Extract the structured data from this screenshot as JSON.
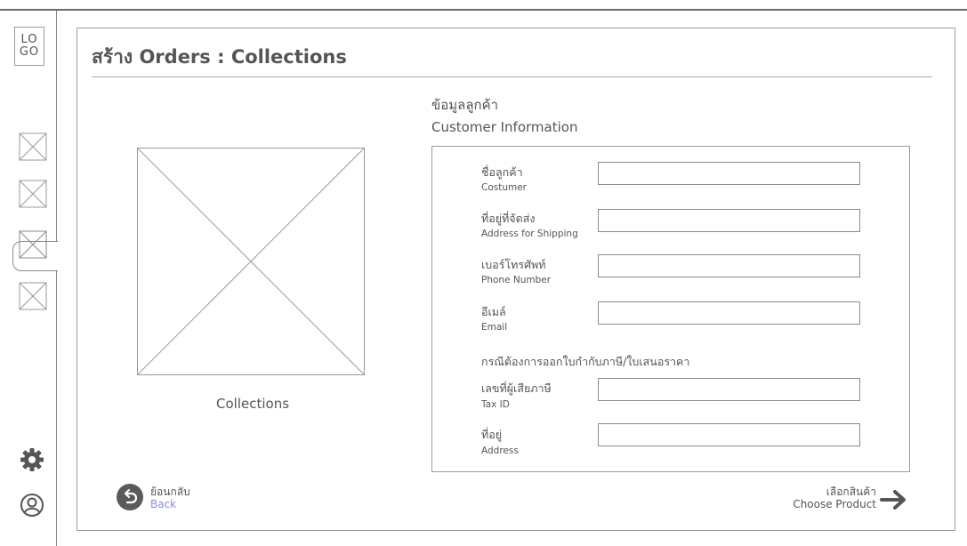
{
  "sidebar": {
    "logo_line1": "LO",
    "logo_line2": "GO",
    "nav_items": [
      {
        "icon": "image-placeholder-icon"
      },
      {
        "icon": "image-placeholder-icon"
      },
      {
        "icon": "image-placeholder-icon",
        "active": true
      },
      {
        "icon": "image-placeholder-icon"
      }
    ],
    "settings_icon": "gear-icon",
    "profile_icon": "user-circle-icon"
  },
  "page": {
    "title": "สร้าง Orders : Collections",
    "collections_label": "Collections"
  },
  "customer": {
    "section_th": "ข้อมูลลูกค้า",
    "section_en": "Customer Information",
    "fields": [
      {
        "label_th": "ชื่อลูกค้า",
        "label_en": "Costumer",
        "value": ""
      },
      {
        "label_th": "ที่อยู่ที่จัดส่ง",
        "label_en": "Address for Shipping",
        "value": ""
      },
      {
        "label_th": "เบอร์โทรศัพท์",
        "label_en": "Phone Number",
        "value": ""
      },
      {
        "label_th": "อีเมล์",
        "label_en": "Email",
        "value": ""
      },
      {
        "label_th": "เลขที่ผู้เสียภาษี",
        "label_en": "Tax ID",
        "value": ""
      },
      {
        "label_th": "ที่อยู่",
        "label_en": "Address",
        "value": ""
      }
    ],
    "tax_note": "กรณีต้องการออกใบกำกับภาษี/ใบเสนอราคา"
  },
  "footer": {
    "back_th": "ย้อนกลับ",
    "back_en": "Back",
    "next_th": "เลือกสินค้า",
    "next_en": "Choose Product"
  },
  "colors": {
    "border": "#9a9a9a",
    "text": "#555555",
    "back_accent": "#8b8bd6",
    "button_fill": "#5a5a5a"
  }
}
